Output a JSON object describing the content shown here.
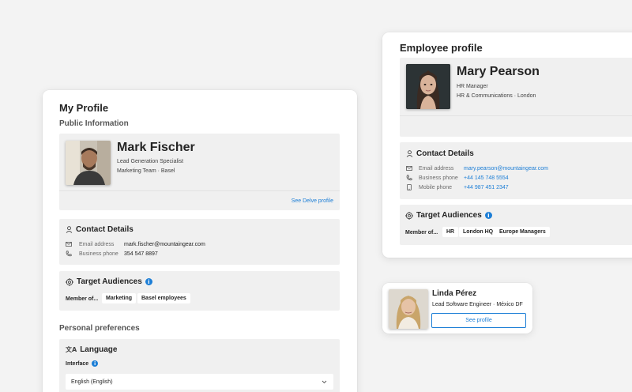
{
  "my_profile": {
    "title": "My Profile",
    "public_info_label": "Public Information",
    "name": "Mark Fischer",
    "job_title": "Lead Generation Specialist",
    "team_location": "Marketing Team · Basel",
    "delve_link": "See Delve profile",
    "contact": {
      "title": "Contact Details",
      "email_label": "Email address",
      "email_value": "mark.fischer@mountaingear.com",
      "phone_label": "Business phone",
      "phone_value": "354 547 8897"
    },
    "audiences": {
      "title": "Target Audiences",
      "member_of": "Member of...",
      "chips": [
        "Marketing",
        "Basel employees"
      ]
    },
    "preferences": {
      "title": "Personal preferences",
      "language_title": "Language",
      "interface_label": "Interface",
      "interface_value": "English (English)"
    }
  },
  "employee_profile": {
    "title": "Employee profile",
    "name": "Mary Pearson",
    "job_title": "HR Manager",
    "team_location": "HR & Communications · London",
    "contact": {
      "title": "Contact Details",
      "email_label": "Email address",
      "email_value": "mary.pearson@mountaingear.com",
      "phone_label": "Business phone",
      "phone_value": "+44 145 748 5554",
      "mobile_label": "Mobile phone",
      "mobile_value": "+44 987 451 2347"
    },
    "audiences": {
      "title": "Target Audiences",
      "member_of": "Member of...",
      "chips": [
        "HR",
        "London HQ",
        "Europe Managers"
      ]
    }
  },
  "mini_card": {
    "name": "Linda Pérez",
    "subtitle": "Lead Software Engineer · México DF",
    "button": "See profile"
  },
  "colors": {
    "accent": "#1c7ed6",
    "panel": "#f0f0f0",
    "background": "#f3f3f3"
  }
}
